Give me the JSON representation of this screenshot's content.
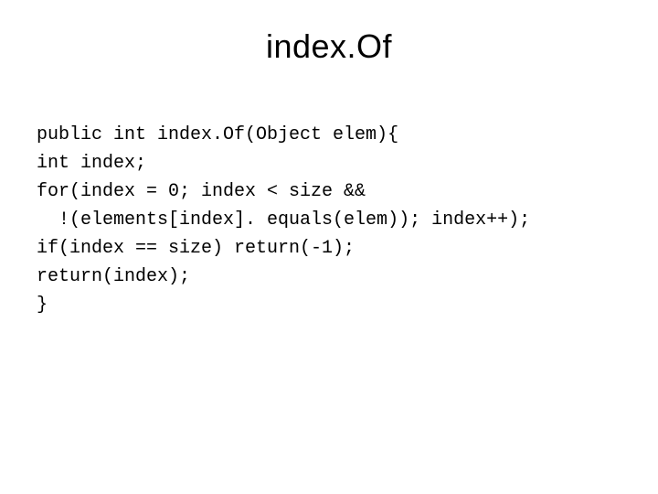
{
  "slide": {
    "title": "index.Of",
    "code": {
      "line1": "public int index.Of(Object elem){",
      "line2": "int index;",
      "line3": "for(index = 0; index < size &&",
      "line4": "  !(elements[index]. equals(elem)); index++);",
      "line5": "if(index == size) return(-1);",
      "line6": "return(index);",
      "line7": "}"
    }
  }
}
